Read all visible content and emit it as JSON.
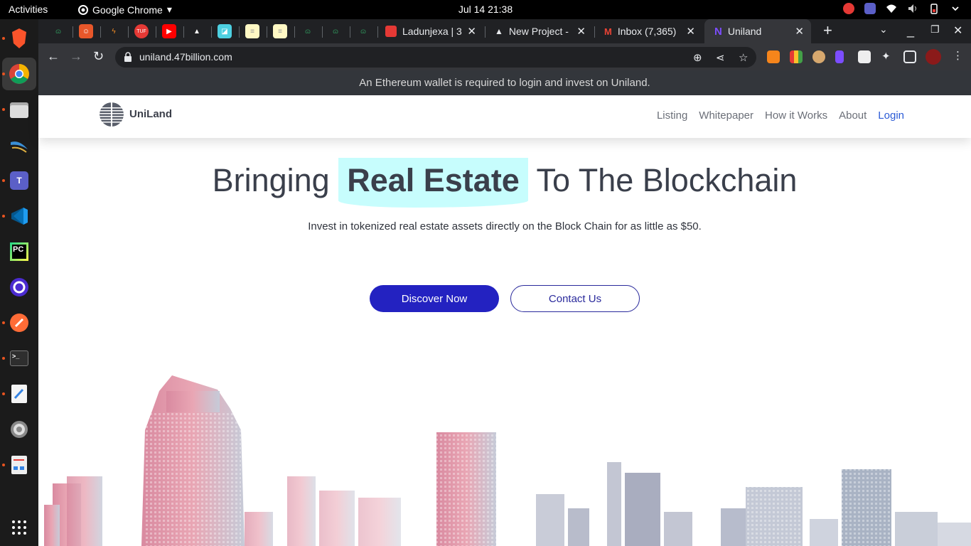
{
  "system": {
    "activities": "Activities",
    "app_name": "Google Chrome",
    "clock": "Jul 14  21:38"
  },
  "tabs": {
    "wide": [
      {
        "title": "Ladunjexa | 3",
        "favicon_color": "#e53935"
      },
      {
        "title": "New Project -",
        "favicon_color": "#ffffff"
      },
      {
        "title": "Inbox (7,365)",
        "favicon_color": "#ea4335"
      },
      {
        "title": "Uniland",
        "favicon_color": "#7c4dff",
        "active": true
      }
    ]
  },
  "browser": {
    "url": "uniland.47billion.com"
  },
  "page": {
    "banner": "An Ethereum wallet is required to login and invest on Uniland.",
    "brand": "UniLand",
    "nav": [
      "Listing",
      "Whitepaper",
      "How it Works",
      "About"
    ],
    "login": "Login",
    "hero_prefix": "Bringing ",
    "hero_highlight": "Real Estate",
    "hero_suffix": " To The Blockchain",
    "subtitle": "Invest in tokenized real estate assets directly on the Block Chain for as little as $50.",
    "cta_primary": "Discover Now",
    "cta_secondary": "Contact Us"
  },
  "colors": {
    "primary_button": "#2322c1",
    "highlight": "#c7fdfd",
    "login_link": "#2b5bd6"
  }
}
